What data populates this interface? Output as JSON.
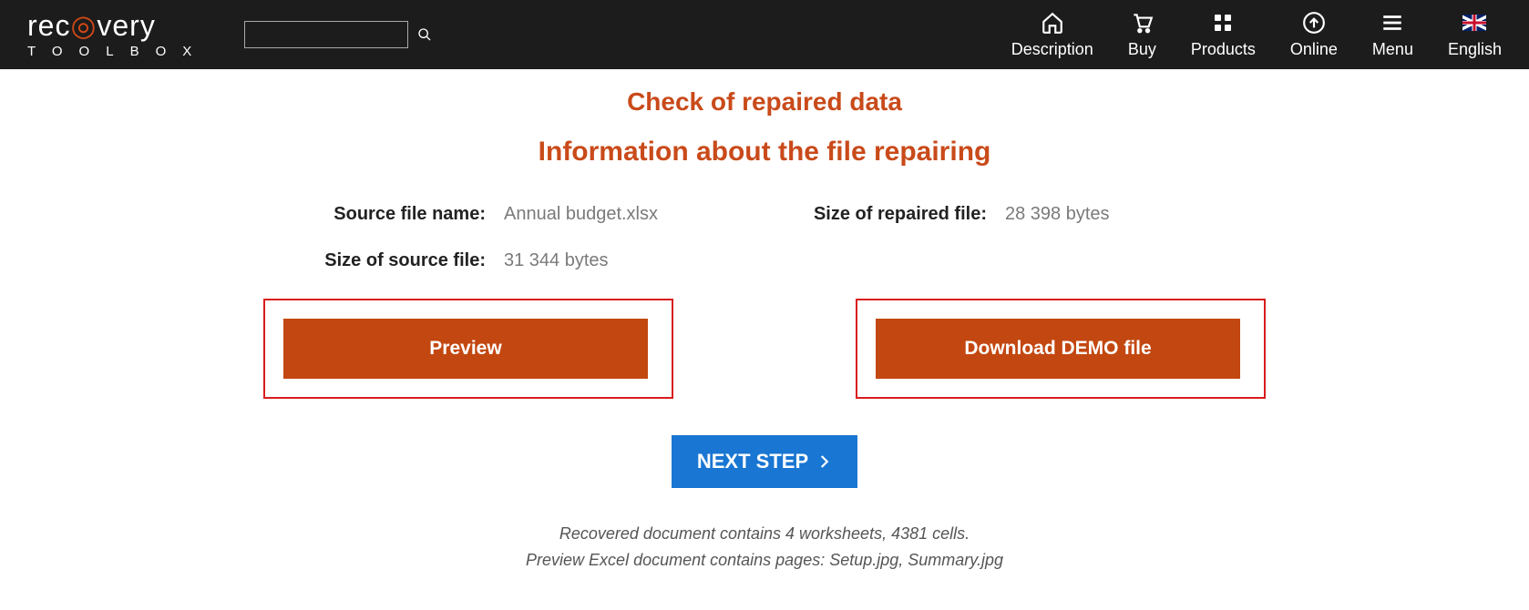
{
  "brand": {
    "top_prefix": "rec",
    "top_suffix": "very",
    "bottom": "TOOLBOX"
  },
  "nav": {
    "description": "Description",
    "buy": "Buy",
    "products": "Products",
    "online": "Online",
    "menu": "Menu",
    "english": "English"
  },
  "headings": {
    "check": "Check of repaired data",
    "info": "Information about the file repairing"
  },
  "info": {
    "source_name_label": "Source file name:",
    "source_name_value": "Annual budget.xlsx",
    "repaired_size_label": "Size of repaired file:",
    "repaired_size_value": "28 398 bytes",
    "source_size_label": "Size of source file:",
    "source_size_value": "31 344 bytes"
  },
  "buttons": {
    "preview": "Preview",
    "download": "Download DEMO file",
    "next": "NEXT STEP"
  },
  "footer": {
    "line1": "Recovered document contains 4 worksheets, 4381 cells.",
    "line2": "Preview Excel document contains pages: Setup.jpg, Summary.jpg"
  },
  "colors": {
    "accent": "#c94a1a",
    "button_orange": "#c34710",
    "button_blue": "#1976d2",
    "frame_red": "#d91c1c"
  }
}
